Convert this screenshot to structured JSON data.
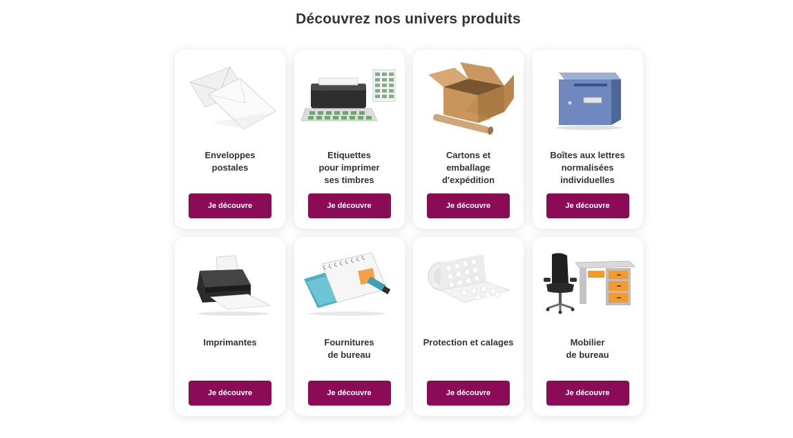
{
  "section": {
    "title": "Découvrez nos univers produits"
  },
  "cards": [
    {
      "label": "Enveloppes\npostales",
      "button": "Je découvre",
      "image": "envelopes-image"
    },
    {
      "label": "Etiquettes\npour imprimer\nses timbres",
      "button": "Je découvre",
      "image": "stamp-labels-printer-image"
    },
    {
      "label": "Cartons et\nemballage\nd'expédition",
      "button": "Je découvre",
      "image": "shipping-box-image"
    },
    {
      "label": "Boîtes aux lettres\nnormalisées\nindividuelles",
      "button": "Je découvre",
      "image": "mailbox-image"
    },
    {
      "label": "Imprimantes",
      "button": "Je découvre",
      "image": "printer-image"
    },
    {
      "label": "Fournitures\nde bureau",
      "button": "Je découvre",
      "image": "office-supplies-image"
    },
    {
      "label": "Protection et calages",
      "button": "Je découvre",
      "image": "bubble-wrap-image"
    },
    {
      "label": "Mobilier\nde bureau",
      "button": "Je découvre",
      "image": "office-furniture-image"
    }
  ],
  "colors": {
    "button_background": "#8c0b57",
    "button_text": "#ffffff",
    "title_text": "#333333"
  }
}
